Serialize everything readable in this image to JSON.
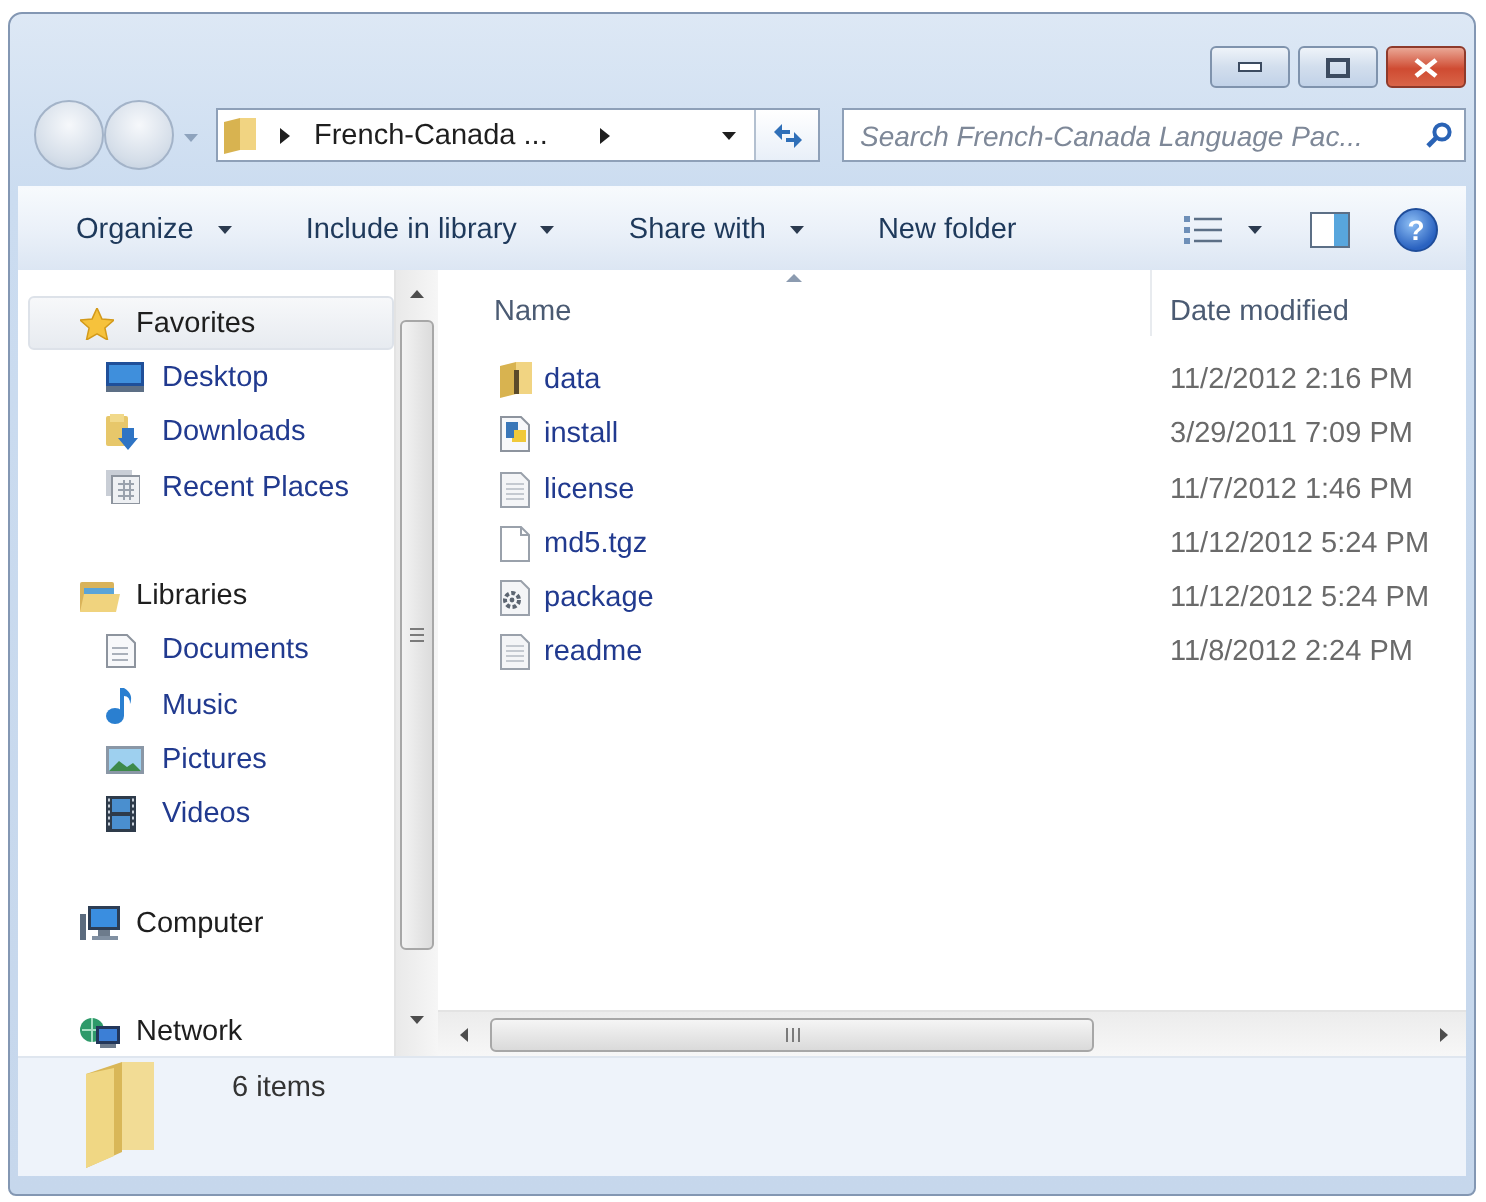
{
  "navigation": {
    "back": {
      "disabled": true
    },
    "forward": {
      "disabled": true
    }
  },
  "address_bar": {
    "segments": [
      "French-Canada ..."
    ]
  },
  "search": {
    "placeholder": "Search French-Canada Language Pac..."
  },
  "toolbar": {
    "items": [
      {
        "label": "Organize",
        "dropdown": true
      },
      {
        "label": "Include in library",
        "dropdown": true
      },
      {
        "label": "Share with",
        "dropdown": true
      },
      {
        "label": "New folder",
        "dropdown": false
      }
    ],
    "help": "?"
  },
  "sidebar": {
    "groups": [
      {
        "label": "Favorites",
        "kind": "favorites",
        "selected": true,
        "children": [
          {
            "label": "Desktop",
            "kind": "desktop",
            "selected": false
          },
          {
            "label": "Downloads",
            "kind": "downloads",
            "selected": false
          },
          {
            "label": "Recent Places",
            "kind": "recent",
            "selected": false
          }
        ]
      },
      {
        "label": "Libraries",
        "kind": "libraries",
        "selected": false,
        "children": [
          {
            "label": "Documents",
            "kind": "documents",
            "selected": false
          },
          {
            "label": "Music",
            "kind": "music",
            "selected": false
          },
          {
            "label": "Pictures",
            "kind": "pictures",
            "selected": false
          },
          {
            "label": "Videos",
            "kind": "videos",
            "selected": false
          }
        ]
      },
      {
        "label": "Computer",
        "kind": "computer",
        "selected": false
      },
      {
        "label": "Network",
        "kind": "network",
        "selected": false
      }
    ]
  },
  "file_list": {
    "columns": [
      {
        "label": "Name",
        "sorted": true
      },
      {
        "label": "Date modified",
        "sorted": false
      }
    ],
    "rows": [
      {
        "kind": "folder",
        "name": "data",
        "date": "11/2/2012 2:16 PM"
      },
      {
        "kind": "script",
        "name": "install",
        "date": "3/29/2011 7:09 PM"
      },
      {
        "kind": "text",
        "name": "license",
        "date": "11/7/2012 1:46 PM"
      },
      {
        "kind": "blank",
        "name": "md5.tgz",
        "date": "11/12/2012 5:24 PM"
      },
      {
        "kind": "settings",
        "name": "package",
        "date": "11/12/2012 5:24 PM"
      },
      {
        "kind": "text",
        "name": "readme",
        "date": "11/8/2012 2:24 PM"
      }
    ]
  },
  "status_bar": {
    "count": "6 items"
  }
}
